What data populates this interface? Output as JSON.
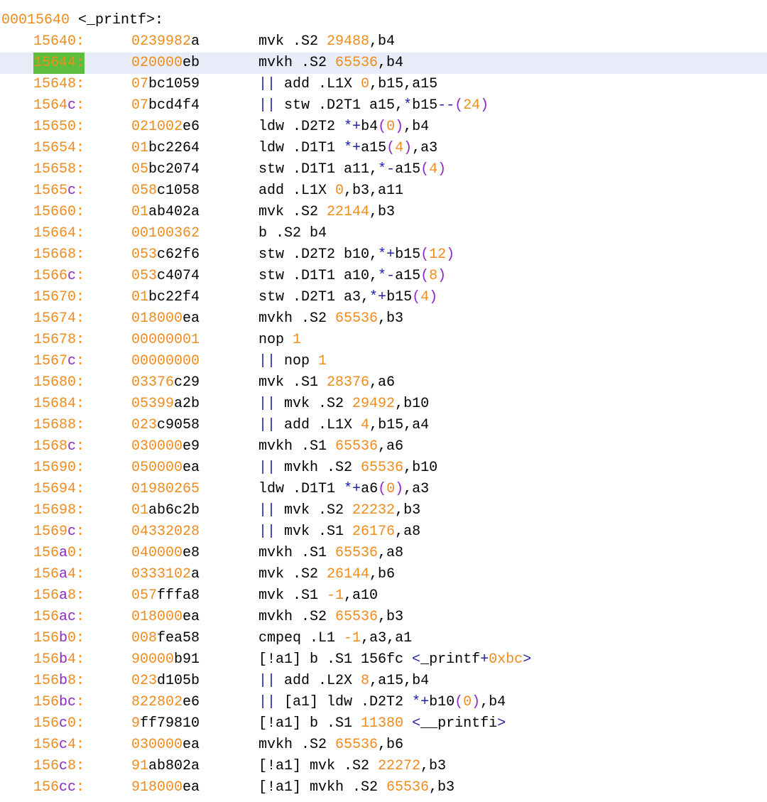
{
  "function": {
    "address": "00015640",
    "name": "<_printf>:"
  },
  "selected_row": 1,
  "colors": {
    "address": "#f08c1e",
    "number": "#f08c1e",
    "operator": "#1e22a8",
    "bracket": "#8a28c8",
    "selection_band": "#e8ecf8",
    "selection_address": "#5cbe3c"
  },
  "rows": [
    {
      "addr": "15640:",
      "hex": "0239982a",
      "asm": "mvk .S2 29488,b4"
    },
    {
      "addr": "15644:",
      "hex": "020000eb",
      "asm": "mvkh .S2 65536,b4"
    },
    {
      "addr": "15648:",
      "hex": "07bc1059",
      "asm": "|| add .L1X 0,b15,a15"
    },
    {
      "addr": "1564c:",
      "hex": "07bcd4f4",
      "asm": "|| stw .D2T1 a15,*b15--(24)"
    },
    {
      "addr": "15650:",
      "hex": "021002e6",
      "asm": "ldw .D2T2 *+b4(0),b4"
    },
    {
      "addr": "15654:",
      "hex": "01bc2264",
      "asm": "ldw .D1T1 *+a15(4),a3"
    },
    {
      "addr": "15658:",
      "hex": "05bc2074",
      "asm": "stw .D1T1 a11,*-a15(4)"
    },
    {
      "addr": "1565c:",
      "hex": "058c1058",
      "asm": "add .L1X 0,b3,a11"
    },
    {
      "addr": "15660:",
      "hex": "01ab402a",
      "asm": "mvk .S2 22144,b3"
    },
    {
      "addr": "15664:",
      "hex": "00100362",
      "asm": "b .S2 b4"
    },
    {
      "addr": "15668:",
      "hex": "053c62f6",
      "asm": "stw .D2T2 b10,*+b15(12)"
    },
    {
      "addr": "1566c:",
      "hex": "053c4074",
      "asm": "stw .D1T1 a10,*-a15(8)"
    },
    {
      "addr": "15670:",
      "hex": "01bc22f4",
      "asm": "stw .D2T1 a3,*+b15(4)"
    },
    {
      "addr": "15674:",
      "hex": "018000ea",
      "asm": "mvkh .S2 65536,b3"
    },
    {
      "addr": "15678:",
      "hex": "00000001",
      "asm": "nop 1"
    },
    {
      "addr": "1567c:",
      "hex": "00000000",
      "asm": "|| nop 1"
    },
    {
      "addr": "15680:",
      "hex": "03376c29",
      "asm": "mvk .S1 28376,a6"
    },
    {
      "addr": "15684:",
      "hex": "05399a2b",
      "asm": "|| mvk .S2 29492,b10"
    },
    {
      "addr": "15688:",
      "hex": "023c9058",
      "asm": "|| add .L1X 4,b15,a4"
    },
    {
      "addr": "1568c:",
      "hex": "030000e9",
      "asm": "mvkh .S1 65536,a6"
    },
    {
      "addr": "15690:",
      "hex": "050000ea",
      "asm": "|| mvkh .S2 65536,b10"
    },
    {
      "addr": "15694:",
      "hex": "01980265",
      "asm": "ldw .D1T1 *+a6(0),a3"
    },
    {
      "addr": "15698:",
      "hex": "01ab6c2b",
      "asm": "|| mvk .S2 22232,b3"
    },
    {
      "addr": "1569c:",
      "hex": "04332028",
      "asm": "|| mvk .S1 26176,a8"
    },
    {
      "addr": "156a0:",
      "hex": "040000e8",
      "asm": "mvkh .S1 65536,a8"
    },
    {
      "addr": "156a4:",
      "hex": "0333102a",
      "asm": "mvk .S2 26144,b6"
    },
    {
      "addr": "156a8:",
      "hex": "057fffa8",
      "asm": "mvk .S1 -1,a10"
    },
    {
      "addr": "156ac:",
      "hex": "018000ea",
      "asm": "mvkh .S2 65536,b3"
    },
    {
      "addr": "156b0:",
      "hex": "008fea58",
      "asm": "cmpeq .L1 -1,a3,a1"
    },
    {
      "addr": "156b4:",
      "hex": "90000b91",
      "asm": "[!a1] b .S1 156fc <_printf+0xbc>"
    },
    {
      "addr": "156b8:",
      "hex": "023d105b",
      "asm": "|| add .L2X 8,a15,b4"
    },
    {
      "addr": "156bc:",
      "hex": "822802e6",
      "asm": "|| [a1] ldw .D2T2 *+b10(0),b4"
    },
    {
      "addr": "156c0:",
      "hex": "9ff79810",
      "asm": "[!a1] b .S1 11380 <__printfi>"
    },
    {
      "addr": "156c4:",
      "hex": "030000ea",
      "asm": "mvkh .S2 65536,b6"
    },
    {
      "addr": "156c8:",
      "hex": "91ab802a",
      "asm": "[!a1] mvk .S2 22272,b3"
    },
    {
      "addr": "156cc:",
      "hex": "918000ea",
      "asm": "[!a1] mvkh .S2 65536,b3"
    }
  ]
}
